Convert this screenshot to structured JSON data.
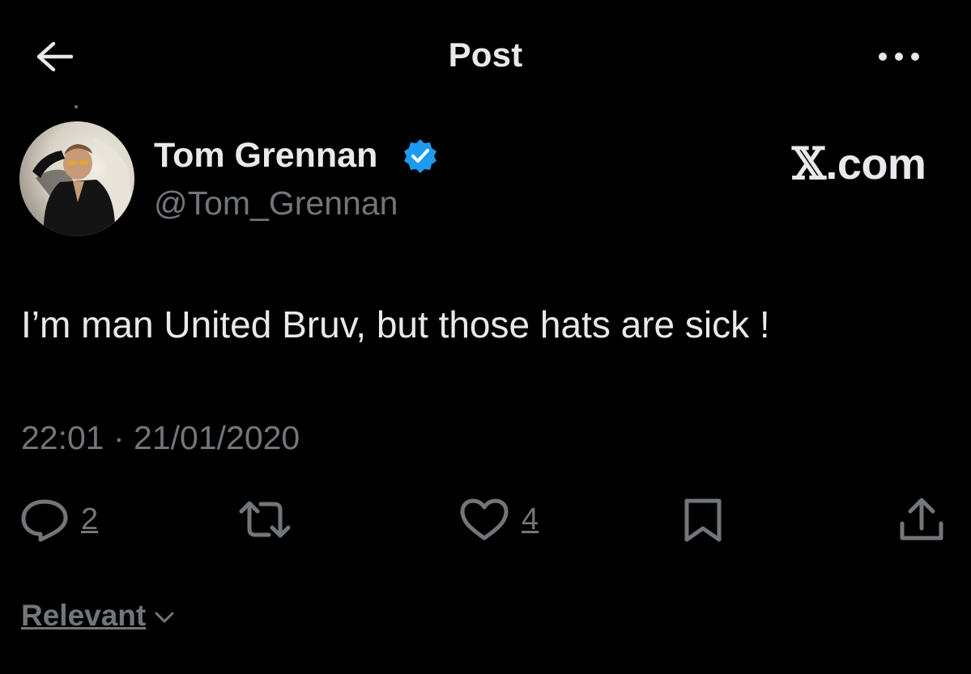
{
  "header": {
    "title": "Post",
    "back_icon": "arrow-left-icon",
    "more_icon": "more-horizontal-icon"
  },
  "author": {
    "display_name": "Tom Grennan",
    "handle": "@Tom_Grennan",
    "verified": true,
    "verified_color": "#1d9bf0",
    "avatar_icon": "profile-photo"
  },
  "watermark": {
    "x_glyph": "𝕏",
    "domain": ".com"
  },
  "post": {
    "text": "I’m man United Bruv, but those hats are sick !",
    "timestamp": "22:01 · 21/01/2020"
  },
  "actions": {
    "reply_count": "2",
    "like_count": "4",
    "icons": [
      "reply-icon",
      "retweet-icon",
      "like-icon",
      "bookmark-icon",
      "share-icon"
    ]
  },
  "sort": {
    "label": "Relevant"
  },
  "colors": {
    "background": "#000000",
    "primary_text": "#e7e9ea",
    "secondary_text": "#71767b",
    "verified": "#1d9bf0"
  }
}
